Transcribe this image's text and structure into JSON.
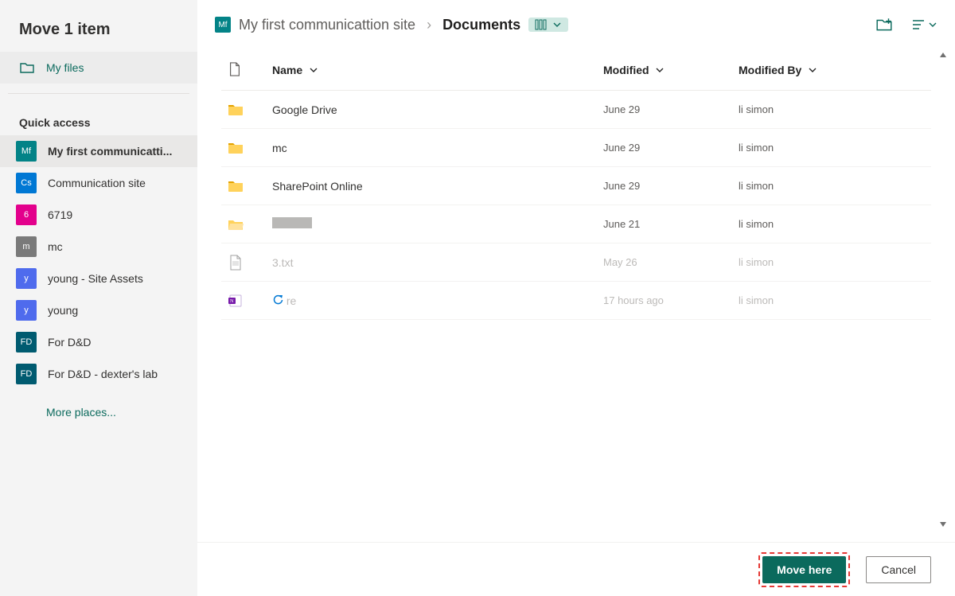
{
  "panel": {
    "title": "Move 1 item",
    "my_files_label": "My files"
  },
  "quick_access": {
    "heading": "Quick access",
    "items": [
      {
        "badge": "Mf",
        "color": "clr-teal",
        "label": "My first communicatti..."
      },
      {
        "badge": "Cs",
        "color": "clr-blue",
        "label": "Communication site"
      },
      {
        "badge": "6",
        "color": "clr-pink",
        "label": "6719"
      },
      {
        "badge": "m",
        "color": "clr-gray",
        "label": "mc"
      },
      {
        "badge": "y",
        "color": "clr-blue2",
        "label": "young - Site Assets"
      },
      {
        "badge": "y",
        "color": "clr-blue2",
        "label": "young"
      },
      {
        "badge": "FD",
        "color": "clr-tealdk",
        "label": "For D&D"
      },
      {
        "badge": "FD",
        "color": "clr-tealdk",
        "label": "For D&D - dexter's lab"
      }
    ],
    "more_label": "More places..."
  },
  "breadcrumb": {
    "site_badge": "Mf",
    "site_name": "My first communicattion site",
    "current": "Documents"
  },
  "columns": {
    "name": "Name",
    "modified": "Modified",
    "modified_by": "Modified By"
  },
  "rows": [
    {
      "type": "folder",
      "name": "Google Drive",
      "modified": "June 29",
      "by": "li simon",
      "muted": false
    },
    {
      "type": "folder",
      "name": "mc",
      "modified": "June 29",
      "by": "li simon",
      "muted": false
    },
    {
      "type": "folder",
      "name": "SharePoint Online",
      "modified": "June 29",
      "by": "li simon",
      "muted": false
    },
    {
      "type": "folder",
      "name": "",
      "modified": "June 21",
      "by": "li simon",
      "muted": false,
      "redacted": true
    },
    {
      "type": "file",
      "name": "3.txt",
      "modified": "May 26",
      "by": "li simon",
      "muted": true
    },
    {
      "type": "onenote",
      "name": "re",
      "modified": "17 hours ago",
      "by": "li simon",
      "muted": true,
      "syncing": true
    }
  ],
  "buttons": {
    "primary": "Move here",
    "secondary": "Cancel"
  },
  "colors": {
    "accent": "#0b6a5d"
  }
}
